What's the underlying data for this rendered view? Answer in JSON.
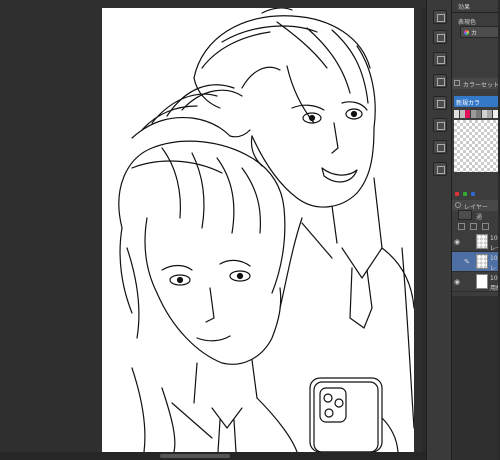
{
  "panel": {
    "effect_label": "効果",
    "display_color_label": "表現色",
    "display_color_value": "カ",
    "color_set_title": "カラーセット",
    "color_set_name": "新規カラ",
    "layer_panel_title": "レイヤー",
    "blend_mode_value": "通",
    "layers": [
      {
        "line1": "10",
        "line2": "レイ"
      },
      {
        "line1": "10",
        "line2": "レ"
      },
      {
        "line1": "10",
        "line2": "用紙"
      }
    ]
  },
  "colors": {
    "accent_blue": "#3478c8",
    "selected_layer": "#4d6fa3",
    "panel_bg": "#3c3c3c",
    "swatches": [
      "#e0e0e0",
      "#bdbdbd",
      "#e2105a",
      "#9a9a9a",
      "#7a7a7a",
      "#d0d0d0",
      "#aaaaaa",
      "#f0f0f0"
    ]
  },
  "icons": {
    "toolstrip": [
      "close-icon",
      "camera-icon",
      "camera-icon",
      "camera-icon",
      "camera-icon",
      "camera-icon",
      "camera-icon",
      "camera-icon"
    ],
    "panel": [
      "color-wheel-icon",
      "color-set-icon",
      "layer-icon",
      "eye-icon",
      "pencil-icon"
    ]
  }
}
